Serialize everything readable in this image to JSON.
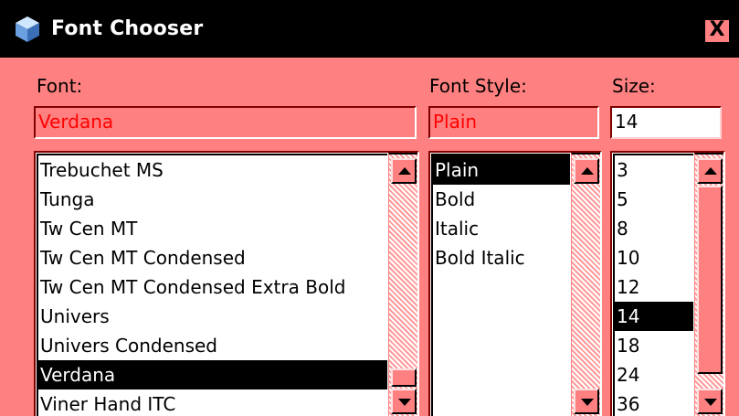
{
  "window": {
    "title": "Font Chooser",
    "close_label": "X"
  },
  "labels": {
    "font": "Font:",
    "style": "Font Style:",
    "size": "Size:"
  },
  "fields": {
    "font_value": "Verdana",
    "style_value": "Plain",
    "size_value": "14"
  },
  "font_list": {
    "items": [
      "Trebuchet MS",
      "Tunga",
      "Tw Cen MT",
      "Tw Cen MT Condensed",
      "Tw Cen MT Condensed Extra Bold",
      "Univers",
      "Univers Condensed",
      "Verdana",
      "Viner Hand ITC"
    ],
    "selected": "Verdana"
  },
  "style_list": {
    "items": [
      "Plain",
      "Bold",
      "Italic",
      "Bold Italic"
    ],
    "selected": "Plain"
  },
  "size_list": {
    "items": [
      "3",
      "5",
      "8",
      "10",
      "12",
      "14",
      "18",
      "24",
      "36"
    ],
    "selected": "14"
  },
  "colors": {
    "background": "#ff8080",
    "titlebar": "#000000",
    "selection": "#000000",
    "readonly_text": "#ff0000"
  }
}
